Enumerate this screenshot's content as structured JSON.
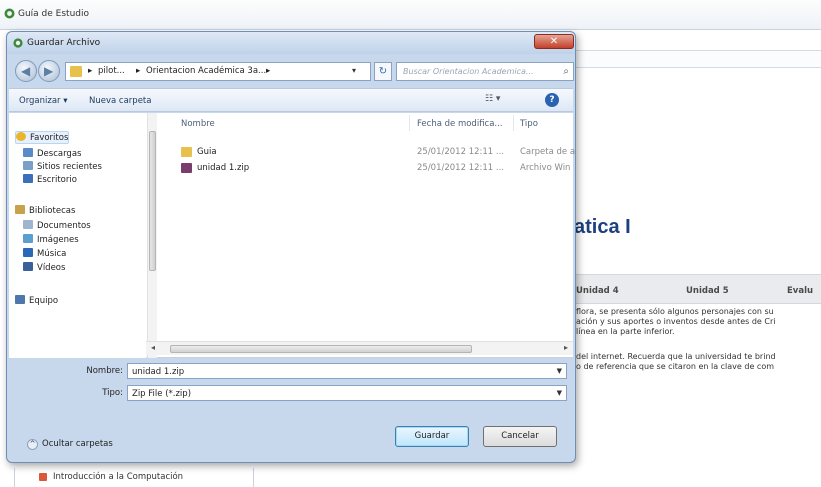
{
  "background_window": {
    "title": "Guía de Estudio",
    "page_title": "atica I",
    "tabs": [
      "Unidad 4",
      "Unidad 5",
      "Evalu"
    ],
    "paragraph1": [
      "flora, se presenta sólo algunos personajes con su",
      "ación y sus aportes o inventos desde antes de Cri",
      "línea en la parte inferior."
    ],
    "paragraph2": [
      "del internet. Recuerda que la universidad te brind",
      "o de referencia que se citaron en la clave de com"
    ],
    "left_link": "Introducción a la Computación"
  },
  "dialog": {
    "title": "Guardar Archivo",
    "close_label": "✕",
    "address_segments": [
      "pilot...",
      "Orientacion Académica 3a...",
      "▸"
    ],
    "search_placeholder": "Buscar Orientacion Academica...",
    "toolbar": {
      "organize": "Organizar ▾",
      "new_folder": "Nueva carpeta"
    },
    "nav_tree": [
      {
        "label": "Favoritos",
        "icon": "star-icon",
        "color": "#e8b52c"
      },
      {
        "label": "Descargas",
        "icon": "downloads-folder-icon",
        "color": "#5b8ac9"
      },
      {
        "label": "Sitios recientes",
        "icon": "recent-places-icon",
        "color": "#7aa0c7"
      },
      {
        "label": "Escritorio",
        "icon": "desktop-icon",
        "color": "#3c6fb7"
      },
      {
        "label": "Bibliotecas",
        "icon": "libraries-icon",
        "color": "#c7a24a"
      },
      {
        "label": "Documentos",
        "icon": "documents-icon",
        "color": "#9fb5cf"
      },
      {
        "label": "Imágenes",
        "icon": "pictures-icon",
        "color": "#5b9fd1"
      },
      {
        "label": "Música",
        "icon": "music-icon",
        "color": "#2a68b8"
      },
      {
        "label": "Vídeos",
        "icon": "videos-icon",
        "color": "#3a5f99"
      },
      {
        "label": "Equipo",
        "icon": "computer-icon",
        "color": "#4e78ab"
      }
    ],
    "columns": {
      "name": "Nombre",
      "date": "Fecha de modifica...",
      "type": "Tipo"
    },
    "files": [
      {
        "name": "Guia",
        "date": "25/01/2012 12:11 ...",
        "type": "Carpeta de a",
        "icon": "folder-icon",
        "color": "#e8c04c"
      },
      {
        "name": "unidad 1.zip",
        "date": "25/01/2012 12:11 ...",
        "type": "Archivo Win",
        "icon": "zip-archive-icon",
        "color": "#7b3d6b"
      }
    ],
    "filename_label": "Nombre:",
    "filename_value": "unidad 1.zip",
    "filetype_label": "Tipo:",
    "filetype_value": "Zip File (*.zip)",
    "hide_folders_label": "Ocultar carpetas",
    "save_label": "Guardar",
    "cancel_label": "Cancelar"
  }
}
